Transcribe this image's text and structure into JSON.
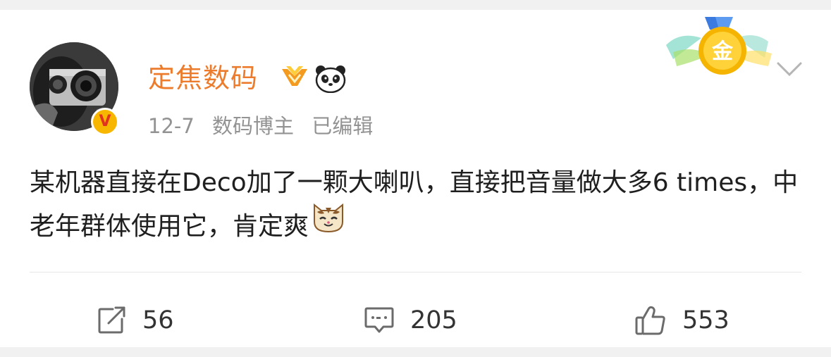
{
  "post": {
    "user": {
      "name": "定焦数码",
      "verified_badge": "V",
      "avatar_icon": "camera-avatar"
    },
    "meta": {
      "date": "12-7",
      "role": "数码博主",
      "edited": "已编辑"
    },
    "medal_icon": "gold-medal-icon",
    "medal_text": "金",
    "text": "某机器直接在Deco加了一颗大喇叭，直接把音量做大多6 times，中老年群体使用它，肯定爽",
    "actions": {
      "share_count": "56",
      "comment_count": "205",
      "like_count": "553"
    }
  },
  "colors": {
    "username": "#ec7c2b",
    "meta": "#939393",
    "text": "#1f1f1f",
    "icon": "#6b6b6b",
    "badge": "#f7b600"
  }
}
